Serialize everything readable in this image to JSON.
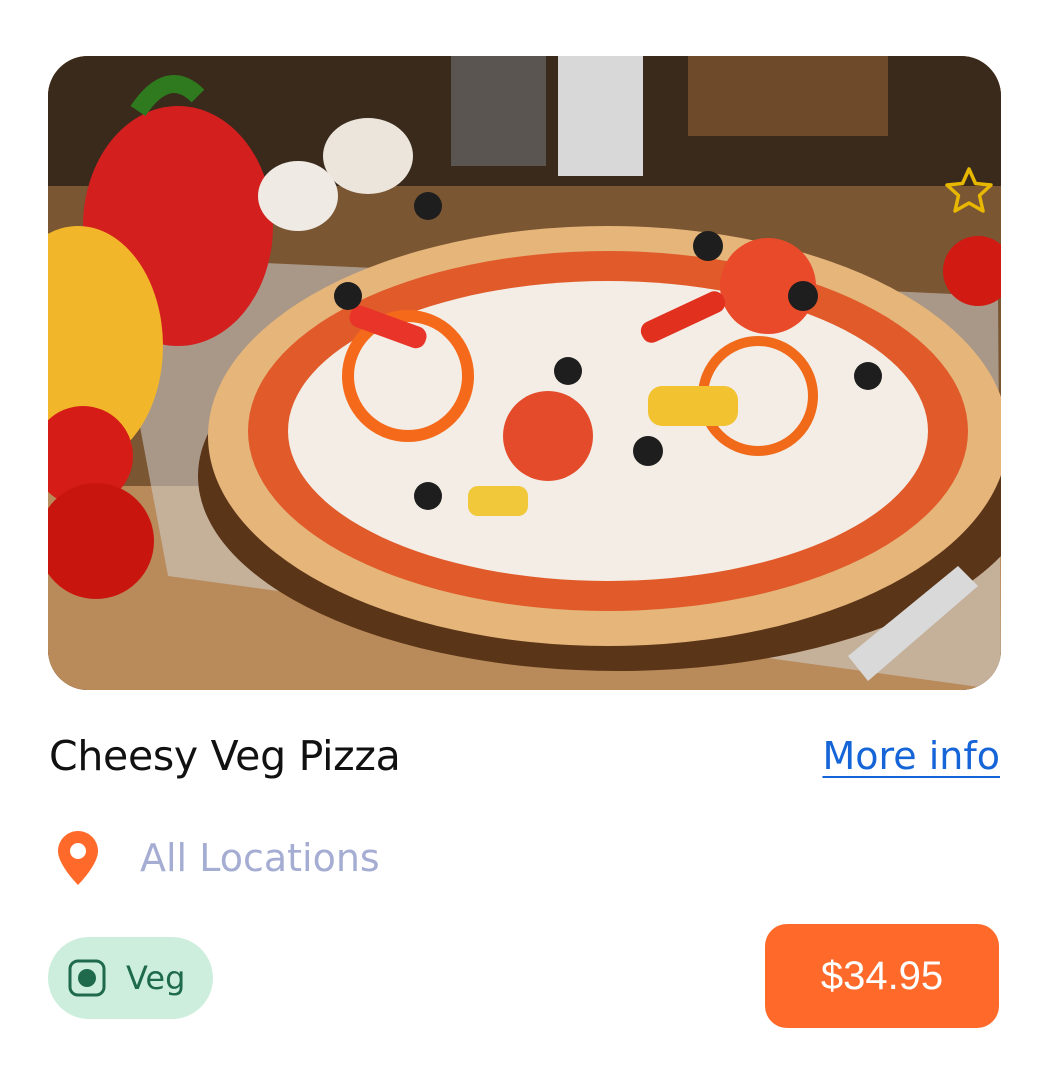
{
  "product": {
    "name": "Cheesy Veg Pizza",
    "more_info_label": "More info",
    "location": "All Locations",
    "diet_label": "Veg",
    "price": "$34.95"
  },
  "icons": {
    "favorite": "star-outline-icon",
    "location": "map-pin-icon",
    "diet": "veg-indicator-icon"
  },
  "colors": {
    "accent": "#ff6a2a",
    "link": "#1565d8",
    "location_text": "#a5add3",
    "veg_badge_bg": "#cdeedd",
    "veg_green": "#1f6a4d",
    "star": "#e8b800"
  }
}
